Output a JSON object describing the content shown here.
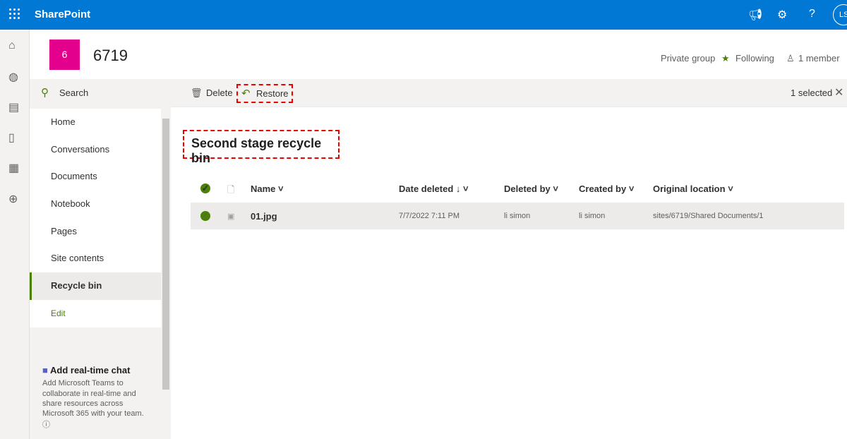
{
  "app": {
    "title": "SharePoint",
    "avatar": "LS"
  },
  "site": {
    "logo_letter": "6",
    "name": "6719",
    "privacy": "Private group",
    "following": "Following",
    "members": "1 member"
  },
  "nav": {
    "search": "Search",
    "items": [
      "Home",
      "Conversations",
      "Documents",
      "Notebook",
      "Pages",
      "Site contents",
      "Recycle bin"
    ],
    "edit": "Edit"
  },
  "chat": {
    "title": "Add real-time chat",
    "body": "Add Microsoft Teams to collaborate in real-time and share resources across Microsoft 365 with your team."
  },
  "commands": {
    "delete": "Delete",
    "restore": "Restore",
    "selected": "1 selected"
  },
  "page": {
    "title": "Second stage recycle bin"
  },
  "table": {
    "columns": [
      "Name",
      "Date deleted",
      "Deleted by",
      "Created by",
      "Original location"
    ],
    "rows": [
      {
        "name": "01.jpg",
        "date_deleted": "7/7/2022 7:11 PM",
        "deleted_by": "li simon",
        "created_by": "li simon",
        "location": "sites/6719/Shared Documents/1"
      }
    ]
  },
  "colors": {
    "brand": "#0078d4",
    "accent": "#498205",
    "logo": "#e3008c",
    "highlight": "#e00000"
  }
}
